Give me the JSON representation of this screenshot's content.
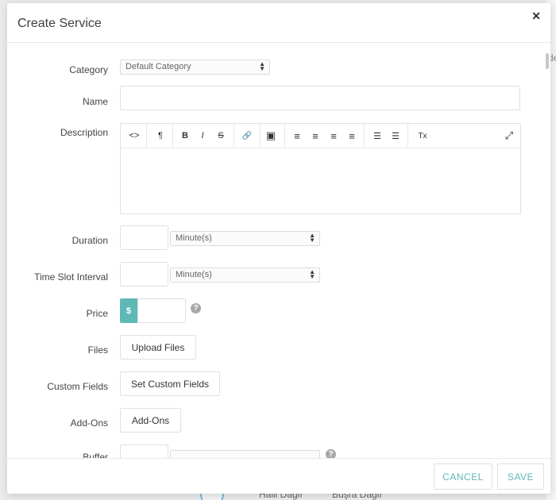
{
  "background": {
    "right_text": "de",
    "names": [
      "Halil Dağlı",
      "Büşra Dağlı"
    ]
  },
  "modal": {
    "title": "Create Service",
    "close_symbol": "✕"
  },
  "form": {
    "category": {
      "label": "Category",
      "value": "Default Category"
    },
    "name": {
      "label": "Name",
      "value": ""
    },
    "description": {
      "label": "Description",
      "toolbar": [
        {
          "icon": "code-view-icon",
          "glyph": "<>"
        },
        {
          "icon": "paragraph-format-icon",
          "glyph": "¶"
        },
        {
          "icon": "bold-icon",
          "glyph": "B"
        },
        {
          "icon": "italic-icon",
          "glyph": "I"
        },
        {
          "icon": "strikethrough-icon",
          "glyph": "S"
        },
        {
          "icon": "link-icon",
          "glyph": "🔗"
        },
        {
          "icon": "image-icon",
          "glyph": "▣"
        },
        {
          "icon": "align-left-icon",
          "glyph": "≡"
        },
        {
          "icon": "align-center-icon",
          "glyph": "≡"
        },
        {
          "icon": "align-right-icon",
          "glyph": "≡"
        },
        {
          "icon": "align-justify-icon",
          "glyph": "≡"
        },
        {
          "icon": "bulleted-list-icon",
          "glyph": "☰"
        },
        {
          "icon": "numbered-list-icon",
          "glyph": "☰"
        },
        {
          "icon": "clear-formatting-icon",
          "glyph": "Tx"
        },
        {
          "icon": "fullscreen-icon",
          "glyph": "⤢"
        }
      ]
    },
    "duration": {
      "label": "Duration",
      "unit": "Minute(s)"
    },
    "time_slot_interval": {
      "label": "Time Slot Interval",
      "unit": "Minute(s)"
    },
    "price": {
      "label": "Price",
      "currency": "$",
      "help": "?"
    },
    "files": {
      "label": "Files",
      "button": "Upload Files"
    },
    "custom_fields": {
      "label": "Custom Fields",
      "button": "Set Custom Fields"
    },
    "add_ons": {
      "label": "Add-Ons",
      "button": "Add-Ons"
    },
    "buffer": {
      "label": "Buffer",
      "help": "?"
    }
  },
  "footer": {
    "cancel": "CANCEL",
    "save": "SAVE"
  }
}
